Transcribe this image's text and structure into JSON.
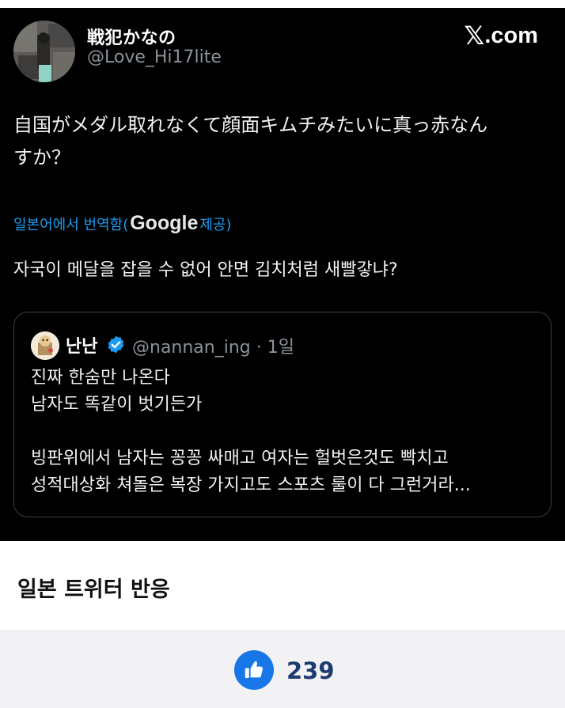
{
  "tweet": {
    "display_name": "戦犯かなの",
    "handle": "@Love_Hi17lite",
    "brand": ".com",
    "text_line1": "自国がメダル取れなくて顔面キムチみたいに真っ赤なん",
    "text_line2": "すか？",
    "translate_prefix": "일본어에서 번역함(",
    "translate_google": "Google",
    "translate_suffix": " 제공)",
    "translated_text": "자국이 메달을 잡을 수 없어 안면 김치처럼 새빨갛냐?"
  },
  "quote": {
    "name": "난난",
    "handle_time": "@nannan_ing · 1일",
    "lines": [
      "진짜 한숨만 나온다",
      "남자도 똑같이 벗기든가",
      "",
      "빙판위에서 남자는 꽁꽁 싸매고 여자는 헐벗은것도 빡치고",
      "성적대상화 쳐돌은 복장 가지고도 스포츠 룰이 다 그런거라..."
    ]
  },
  "caption": "일본 트위터 반응",
  "like": {
    "count": "239"
  },
  "colors": {
    "card_bg": "#000000",
    "link_blue": "#1d9bf0",
    "like_blue": "#1877e8",
    "count_navy": "#1e3a70"
  }
}
